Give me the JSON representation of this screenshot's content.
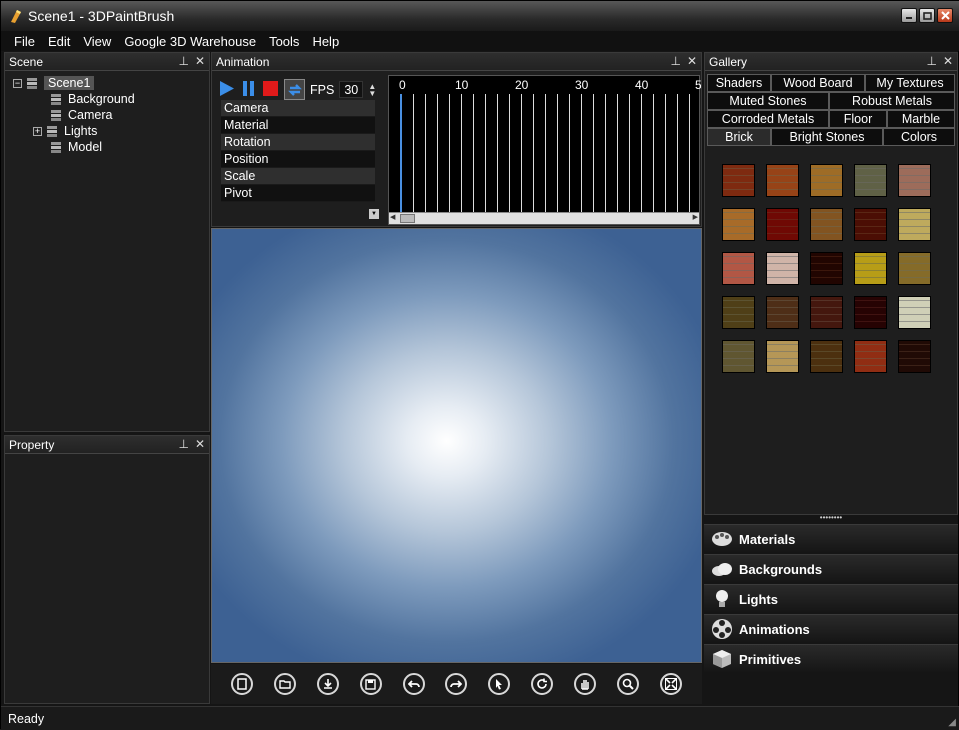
{
  "window": {
    "title": "Scene1 - 3DPaintBrush"
  },
  "menu": [
    "File",
    "Edit",
    "View",
    "Google 3D Warehouse",
    "Tools",
    "Help"
  ],
  "scene_panel": {
    "title": "Scene",
    "tree": {
      "root": "Scene1",
      "children": [
        "Background",
        "Camera",
        "Lights",
        "Model"
      ]
    }
  },
  "property_panel": {
    "title": "Property"
  },
  "animation_panel": {
    "title": "Animation",
    "fps_label": "FPS",
    "fps_value": "30",
    "tracks": [
      "Camera",
      "Material",
      "Rotation",
      "Position",
      "Scale",
      "Pivot"
    ],
    "timeline_ticks": [
      "0",
      "10",
      "20",
      "30",
      "40",
      "5"
    ]
  },
  "gallery_panel": {
    "title": "Gallery",
    "tab_rows": [
      [
        "Shaders",
        "Wood Board",
        "My Textures"
      ],
      [
        "Muted Stones",
        "Robust Metals"
      ],
      [
        "Corroded Metals",
        "Floor",
        "Marble"
      ],
      [
        "Brick",
        "Bright Stones",
        "Colors"
      ]
    ],
    "active_tab": "Brick",
    "texture_colors": [
      "#b3673f",
      "#c4834c",
      "#c9a663",
      "#9c9d86",
      "#c8a698",
      "#cfa566",
      "#a8301f",
      "#b6925c",
      "#8a3c21",
      "#dcd09a",
      "#d59585",
      "#e6d6cf",
      "#5c2313",
      "#d8c84c",
      "#b8a566",
      "#8e7f4c",
      "#8d6c4c",
      "#844d3c",
      "#631d1a",
      "#e6e6d8",
      "#9c9470",
      "#d7c495",
      "#8b6f3e",
      "#c06b46",
      "#5a3323"
    ]
  },
  "library": {
    "items": [
      "Materials",
      "Backgrounds",
      "Lights",
      "Animations",
      "Primitives"
    ]
  },
  "status": {
    "text": "Ready"
  }
}
